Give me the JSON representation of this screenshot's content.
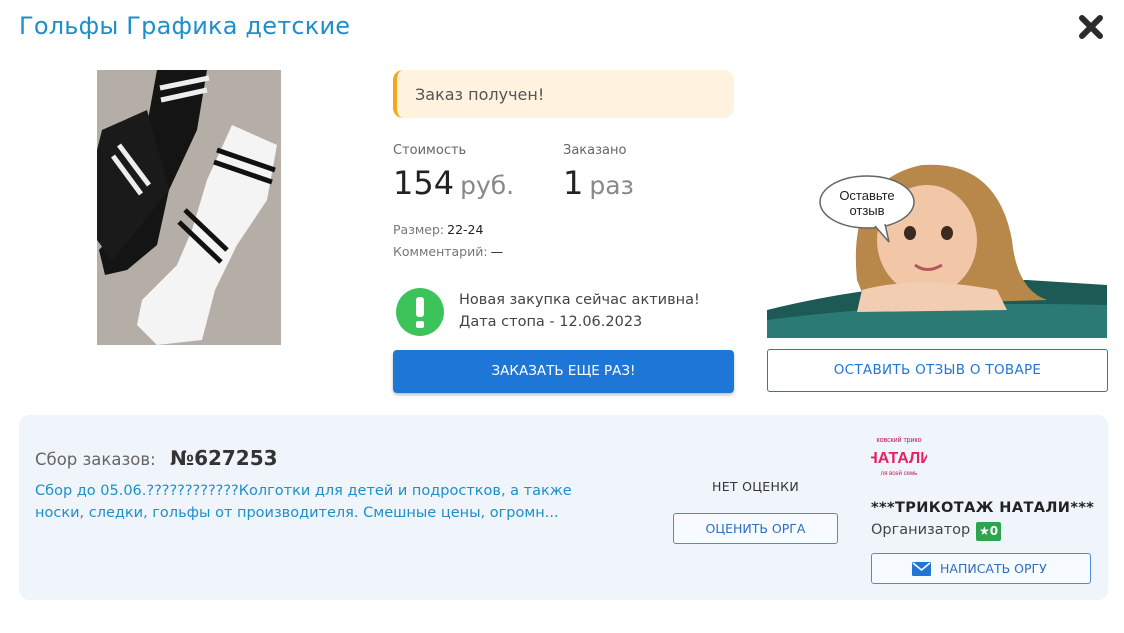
{
  "header": {
    "title": "Гольфы Графика детские",
    "close_icon": "close-icon"
  },
  "order": {
    "status": "Заказ получен!",
    "price_label": "Стоимость",
    "price_value": "154",
    "price_unit": "руб.",
    "qty_label": "Заказано",
    "qty_value": "1",
    "qty_unit": "раз",
    "size_label": "Размер:",
    "size_value": "22-24",
    "comment_label": "Комментарий:",
    "comment_value": "—",
    "active_line1": "Новая закупка сейчас активна!",
    "active_line2": "Дата стопа - 12.06.2023",
    "order_again_label": "ЗАКАЗАТЬ ЕЩЕ РАЗ!"
  },
  "review": {
    "bubble_line1": "Оставьте",
    "bubble_line2": "отзыв",
    "button_label": "ОСТАВИТЬ ОТЗЫВ О ТОВАРЕ"
  },
  "collection": {
    "label": "Сбор заказов:",
    "number": "№627253",
    "description": "Сбор до 05.06.????????????Колготки для детей и подростков, а также носки, следки, гольфы от производителя. Смешные цены, огромн...",
    "no_rating": "НЕТ ОЦЕНКИ",
    "rate_label": "ОЦЕНИТЬ ОРГА"
  },
  "organizer": {
    "logo_top": "ковский трико",
    "logo_main": "НАТАЛИ",
    "logo_bottom": "ля всей семь",
    "name": "***ТРИКОТАЖ НАТАЛИ***",
    "role": "Организатор",
    "rating_badge": "★0",
    "write_label": "НАПИСАТЬ ОРГУ"
  },
  "colors": {
    "accent_blue": "#1e76d6",
    "title_blue": "#1e8fc9",
    "status_bg": "#fff3e0",
    "status_border": "#f5a623",
    "active_green": "#3cc45b"
  }
}
